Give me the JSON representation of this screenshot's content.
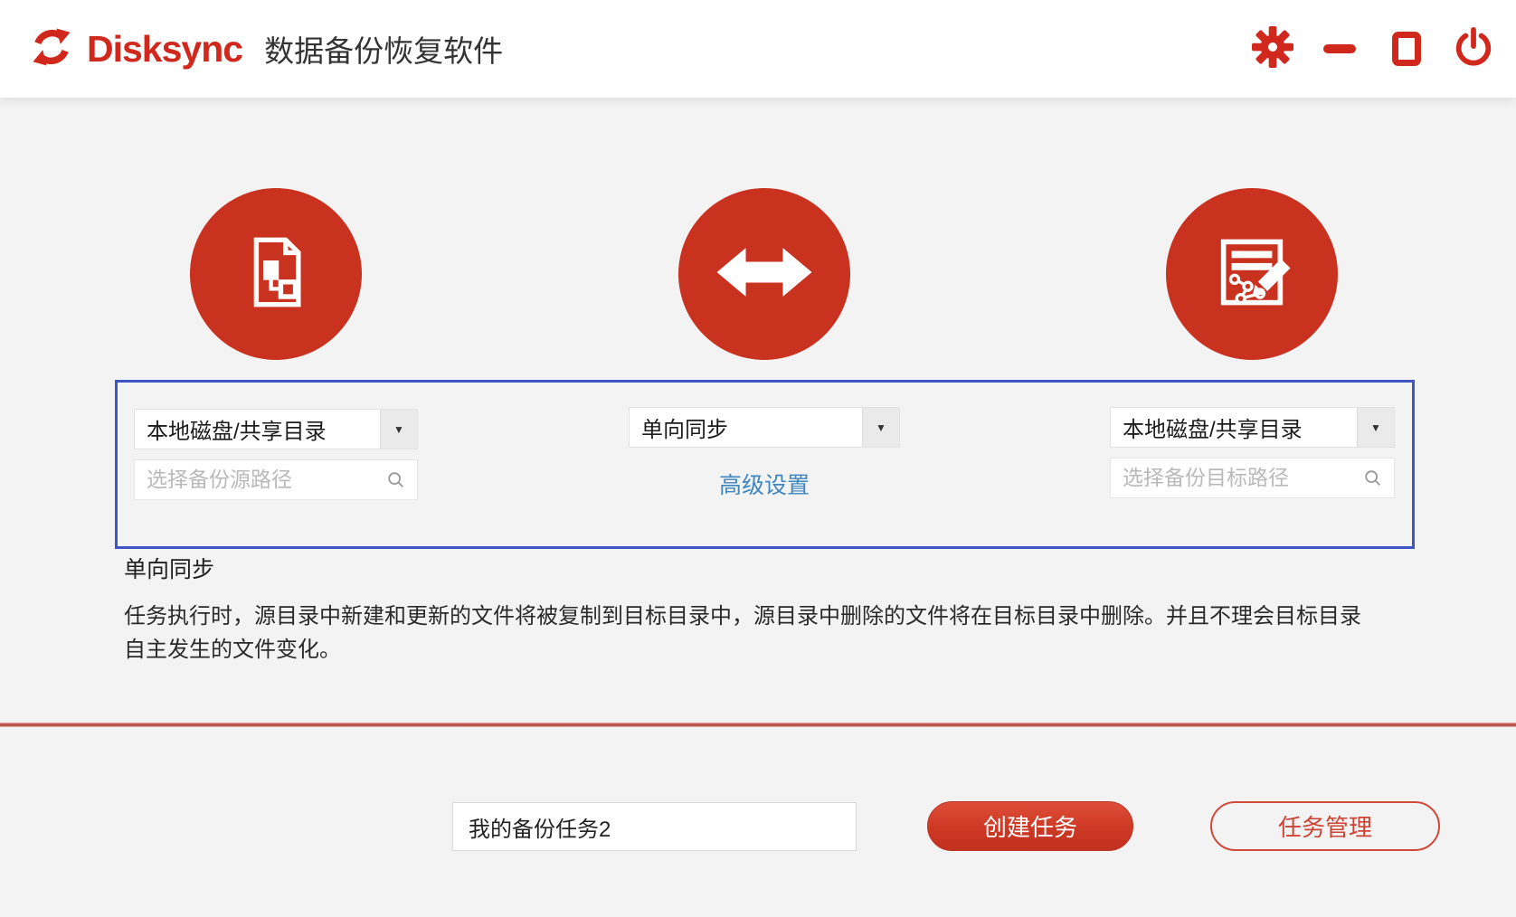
{
  "colors": {
    "accent_red": "#d0281c",
    "circle_red": "#c8321f",
    "button_red": "#cd3824",
    "panel_border_blue": "#3d56c4",
    "link_blue": "#3e86c0",
    "page_bg": "#f3f3f3"
  },
  "header": {
    "brand": "Disksync",
    "title": "数据备份恢复软件"
  },
  "wizard": {
    "source": {
      "type_selected": "本地磁盘/共享目录",
      "path_placeholder": "选择备份源路径"
    },
    "mode": {
      "selected": "单向同步",
      "advanced_link": "高级设置"
    },
    "target": {
      "type_selected": "本地磁盘/共享目录",
      "path_placeholder": "选择备份目标路径"
    }
  },
  "info": {
    "mode_label": "单向同步",
    "description_lines": [
      "任务执行时，源目录中新建和更新的文件将被复制到目标目录中，源目录中删除的文件将在目标目录中删除。并且不理会目标目录",
      "自主发生的文件变化。"
    ]
  },
  "footer": {
    "task_name": "我的备份任务2",
    "create_button": "创建任务",
    "manage_button": "任务管理"
  }
}
